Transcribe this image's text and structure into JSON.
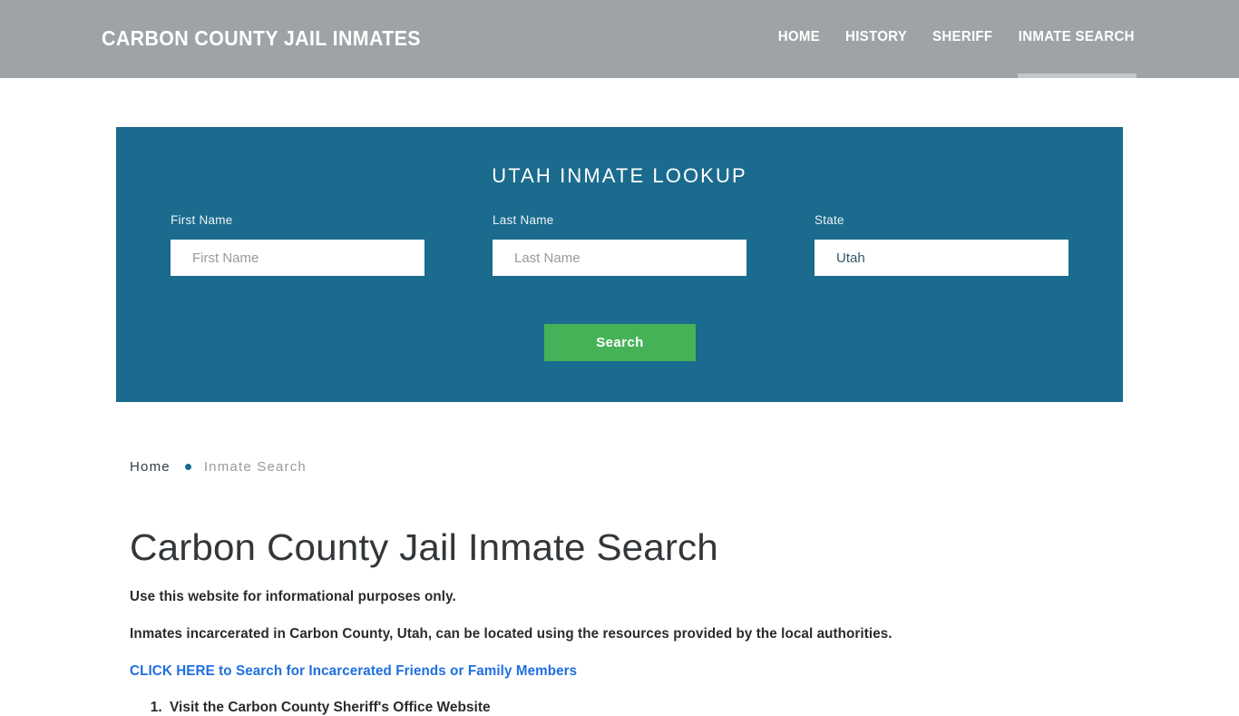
{
  "header": {
    "site_title": "CARBON COUNTY JAIL INMATES",
    "nav": [
      {
        "label": "HOME",
        "active": false
      },
      {
        "label": "HISTORY",
        "active": false
      },
      {
        "label": "SHERIFF",
        "active": false
      },
      {
        "label": "INMATE SEARCH",
        "active": true
      }
    ],
    "background_color": "#9ea3a6",
    "active_indicator_color": "#c3c7c9"
  },
  "search_panel": {
    "title": "UTAH INMATE LOOKUP",
    "background_color": "#1a6b8d",
    "fields": [
      {
        "label": "First Name",
        "placeholder": "First Name",
        "value": ""
      },
      {
        "label": "Last Name",
        "placeholder": "Last Name",
        "value": ""
      },
      {
        "label": "State",
        "placeholder": "State",
        "value": "Utah"
      }
    ],
    "submit_label": "Search",
    "submit_color": "#46b257"
  },
  "breadcrumb": {
    "home_label": "Home",
    "separator": "•",
    "current_label": "Inmate Search"
  },
  "main": {
    "page_title": "Carbon County Jail Inmate Search",
    "paragraph_1": "Use this website for informational purposes only.",
    "paragraph_2": "Inmates incarcerated in Carbon County, Utah, can be located using the resources provided by the local authorities.",
    "link_text": "CLICK HERE to Search for Incarcerated Friends or Family Members",
    "link_color": "#1f6fe0",
    "list_items": [
      "Visit the Carbon County Sheriff's Office Website"
    ]
  }
}
